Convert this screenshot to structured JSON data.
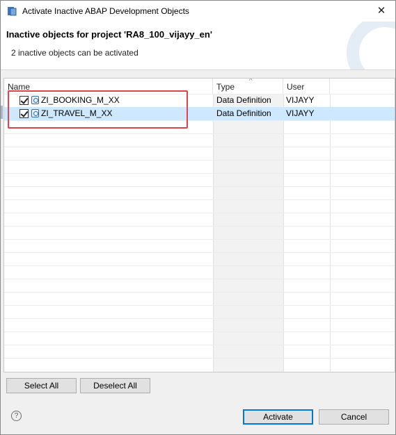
{
  "window": {
    "title": "Activate Inactive ABAP Development Objects",
    "close_glyph": "✕"
  },
  "banner": {
    "title": "Inactive objects for project 'RA8_100_vijayy_en'",
    "subtitle": "2 inactive objects can be activated"
  },
  "table": {
    "columns": {
      "name": "Name",
      "type": "Type",
      "user": "User"
    },
    "sort_glyph": "^",
    "rows": [
      {
        "name": "ZI_BOOKING_M_XX",
        "type": "Data Definition",
        "user": "VIJAYY",
        "checked": true,
        "selected": false
      },
      {
        "name": "ZI_TRAVEL_M_XX",
        "type": "Data Definition",
        "user": "VIJAYY",
        "checked": true,
        "selected": true
      }
    ]
  },
  "buttons": {
    "select_all": "Select All",
    "deselect_all": "Deselect All",
    "activate": "Activate",
    "cancel": "Cancel",
    "help_glyph": "?"
  },
  "colors": {
    "selection": "#cde8ff",
    "annotation_box": "#e0424a",
    "default_button_border": "#0078d7"
  },
  "icons": [
    "app-icon",
    "close-icon",
    "checkbox-checked-icon",
    "data-definition-icon",
    "help-icon"
  ]
}
